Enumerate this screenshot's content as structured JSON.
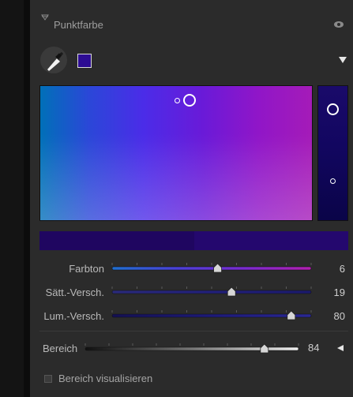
{
  "panel": {
    "title": "Punktfarbe",
    "swatch_color": "#2d0c93",
    "icons": [
      "disclosure-triangle-icon",
      "eye-icon",
      "eyedropper-icon",
      "dropdown-triangle-icon",
      "range-collapse-triangle-icon"
    ]
  },
  "sliders": [
    {
      "label": "Farbton",
      "value": "6",
      "position_fraction": 0.53
    },
    {
      "label": "Sätt.-Versch.",
      "value": "19",
      "position_fraction": 0.6
    },
    {
      "label": "Lum.-Versch.",
      "value": "80",
      "position_fraction": 0.9
    }
  ],
  "range": {
    "label": "Bereich",
    "value": "84",
    "position_fraction": 0.84
  },
  "visualize": {
    "label": "Bereich visualisieren",
    "checked": false
  }
}
